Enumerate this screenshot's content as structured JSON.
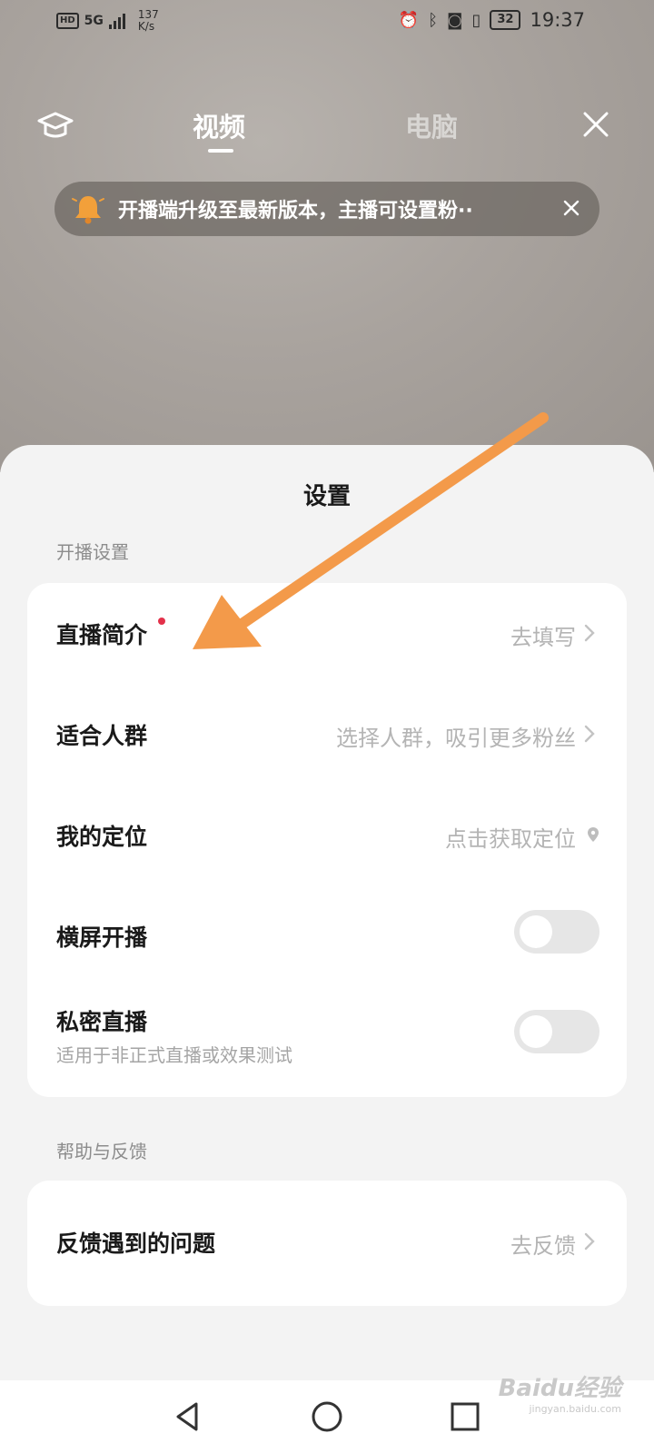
{
  "status_bar": {
    "hd": "HD",
    "network": "5G",
    "speed_value": "137",
    "speed_unit": "K/s",
    "battery": "32",
    "time": "19:37"
  },
  "top_nav": {
    "tabs": [
      {
        "label": "视频",
        "active": true
      },
      {
        "label": "电脑",
        "active": false
      }
    ],
    "left_icon": "graduation-cap-icon",
    "right_icon": "close-icon"
  },
  "notice": {
    "text": "开播端升级至最新版本，主播可设置粉··"
  },
  "sheet": {
    "title": "设置",
    "sections": [
      {
        "label": "开播设置",
        "rows": [
          {
            "label": "直播简介",
            "value": "去填写",
            "has_dot": true
          },
          {
            "label": "适合人群",
            "value": "选择人群，吸引更多粉丝"
          },
          {
            "label": "我的定位",
            "value": "点击获取定位"
          },
          {
            "label": "横屏开播",
            "toggle_on": false
          },
          {
            "label": "私密直播",
            "sub": "适用于非正式直播或效果测试",
            "toggle_on": false
          }
        ]
      },
      {
        "label": "帮助与反馈",
        "rows": [
          {
            "label": "反馈遇到的问题",
            "value": "去反馈"
          }
        ]
      }
    ]
  },
  "watermark": {
    "text": "Baidu经验",
    "url": "jingyan.baidu.com"
  },
  "colors": {
    "accent_dot": "#e3314a",
    "annotation_arrow": "#f39a4a",
    "card_bg": "#ffffff",
    "sheet_bg": "#f3f3f3"
  }
}
